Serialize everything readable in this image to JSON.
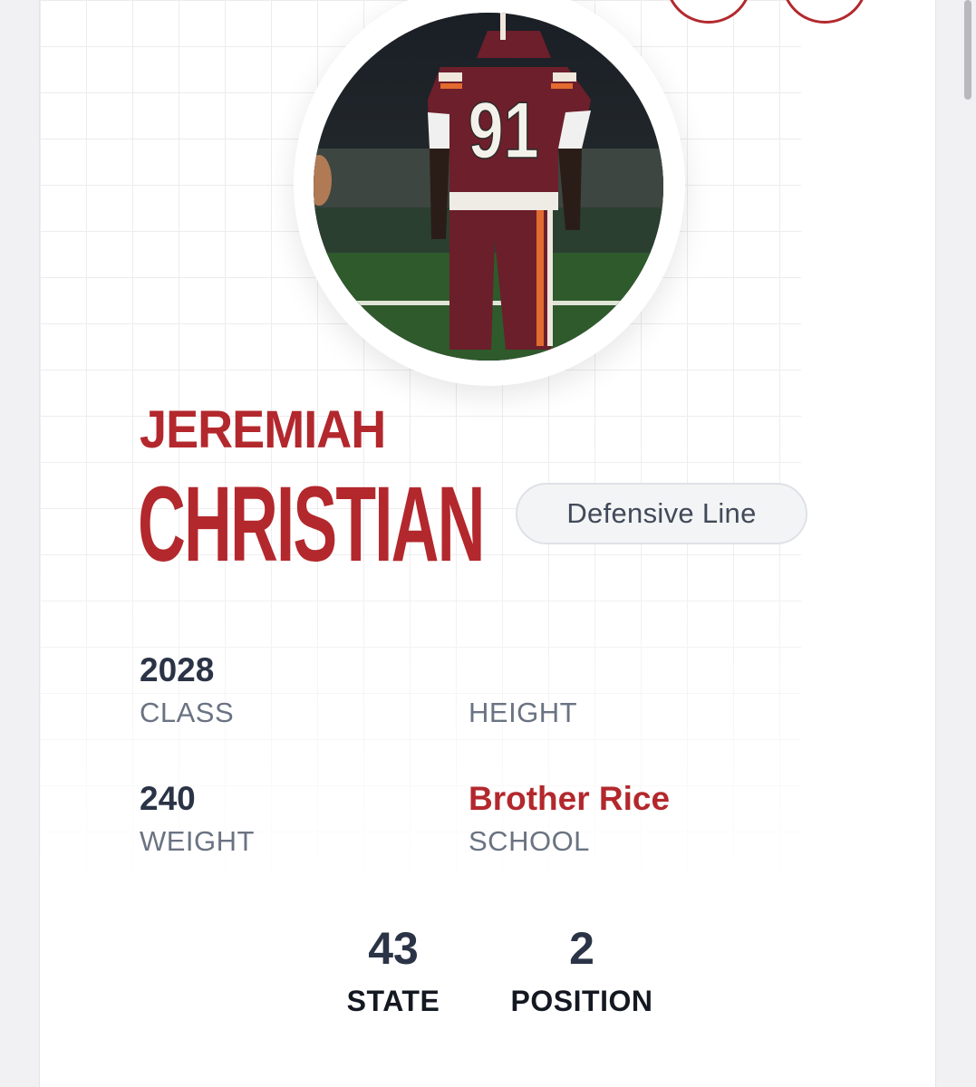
{
  "player": {
    "first_name": "JEREMIAH",
    "last_name": "CHRISTIAN",
    "position": "Defensive Line",
    "photo_jersey_number": "91"
  },
  "stats": {
    "class": {
      "value": "2028",
      "label": "CLASS"
    },
    "height": {
      "value": "",
      "label": "HEIGHT"
    },
    "weight": {
      "value": "240",
      "label": "WEIGHT"
    },
    "school": {
      "value": "Brother Rice",
      "label": "SCHOOL"
    }
  },
  "rankings": {
    "state": {
      "value": "43",
      "label": "STATE"
    },
    "position": {
      "value": "2",
      "label": "POSITION"
    }
  },
  "colors": {
    "accent": "#b3282d",
    "text_dark": "#2b3446",
    "text_muted": "#6a7382"
  },
  "icons": [
    "top-action-icon",
    "top-action-icon"
  ]
}
